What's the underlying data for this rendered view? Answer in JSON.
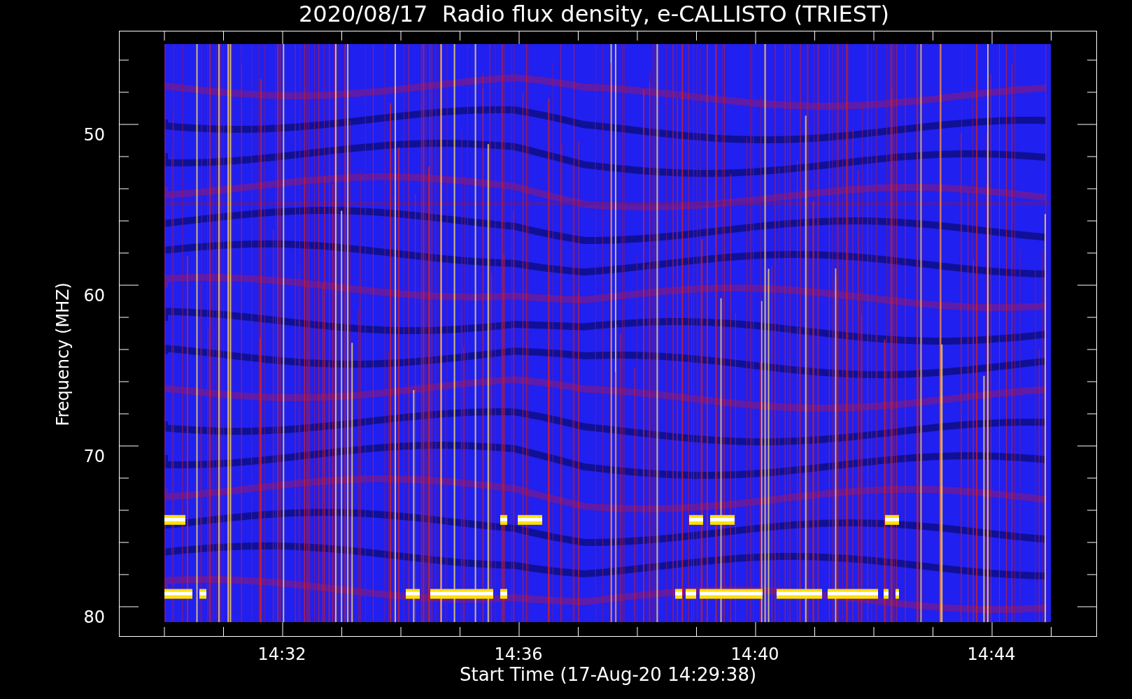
{
  "title": "2020/08/17  Radio flux density, e-CALLISTO (TRIEST)",
  "y_axis": {
    "label": "Frequency (MHZ)",
    "ticks": [
      "50",
      "60",
      "70",
      "80"
    ]
  },
  "x_axis": {
    "label": "Start Time (17-Aug-20 14:29:38)",
    "ticks": [
      "14:32",
      "14:36",
      "14:40",
      "14:44"
    ]
  }
}
